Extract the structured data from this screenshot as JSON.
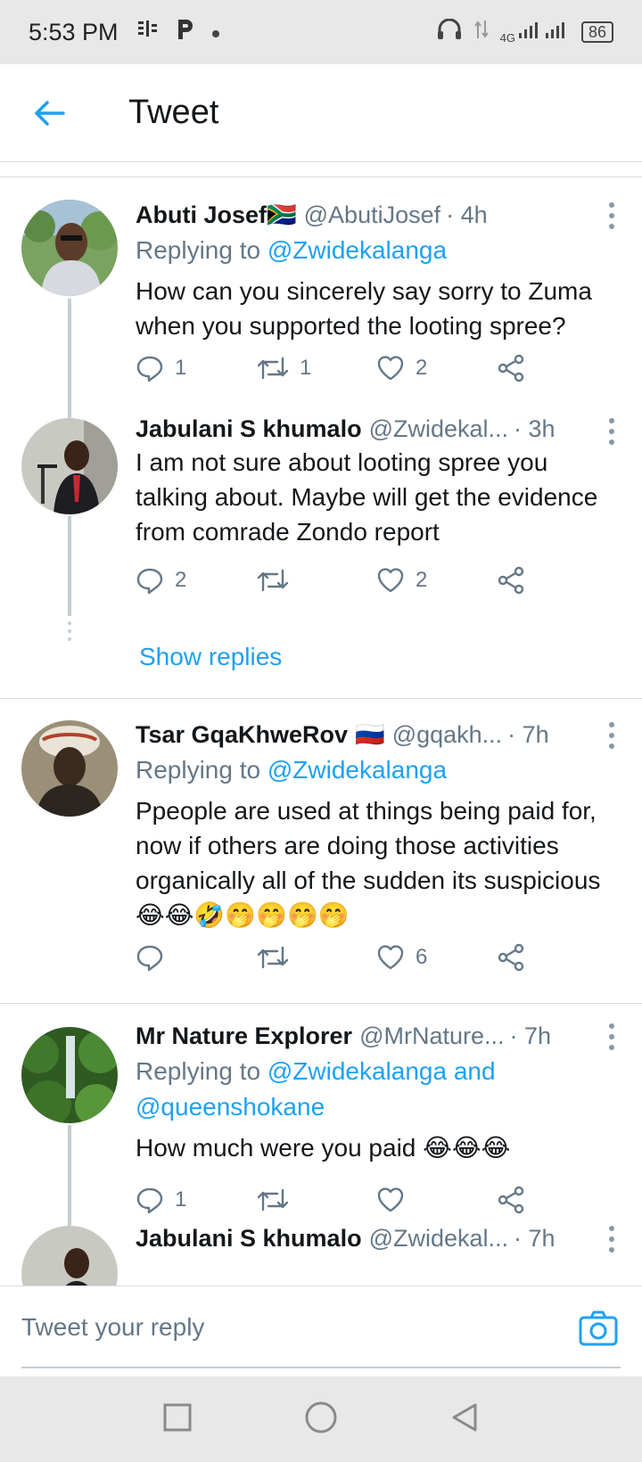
{
  "status_bar": {
    "time": "5:53 PM",
    "network": "4G",
    "battery": "86"
  },
  "header": {
    "title": "Tweet"
  },
  "tweets": [
    {
      "name": "Abuti Josef",
      "flag": "🇿🇦",
      "handle": "@AbutiJosef",
      "time": "· 4h",
      "replying_prefix": "Replying to ",
      "replying_to": "@Zwidekalanga",
      "text": "How can you sincerely say sorry to Zuma when you supported the looting spree?",
      "replies": "1",
      "retweets": "1",
      "likes": "2"
    },
    {
      "name": "Jabulani S khumalo",
      "handle": "@Zwidekal...",
      "time": "· 3h",
      "text": "I am not sure about looting spree you talking about. Maybe will get the evidence from comrade Zondo report",
      "replies": "2",
      "retweets": "",
      "likes": "2",
      "show_replies": "Show replies"
    },
    {
      "name": "Tsar GqaKhweRov",
      "flag": "🇷🇺",
      "handle": "@gqakh...",
      "time": "· 7h",
      "replying_prefix": "Replying to ",
      "replying_to": "@Zwidekalanga",
      "text": "Ppeople are used at things being paid for, now if others are doing those activities organically all of the sudden its suspicious 😂😂🤣🤭🤭🤭🤭",
      "replies": "",
      "retweets": "",
      "likes": "6"
    },
    {
      "name": "Mr Nature Explorer",
      "handle": "@MrNature...",
      "time": "· 7h",
      "replying_prefix": "Replying to ",
      "replying_to": "@Zwidekalanga and @queenshokane",
      "text": "How much were you paid 😂😂😂",
      "replies": "1",
      "retweets": "",
      "likes": ""
    },
    {
      "name": "Jabulani S khumalo",
      "handle": "@Zwidekal...",
      "time": "· 7h"
    }
  ],
  "composer": {
    "placeholder": "Tweet your reply"
  },
  "colors": {
    "accent": "#1da1f2",
    "secondary_text": "#657786",
    "divider": "#d7dde1"
  },
  "icons": [
    "back-arrow-icon",
    "more-icon",
    "reply-icon",
    "retweet-icon",
    "like-icon",
    "share-icon",
    "camera-icon",
    "nav-square-icon",
    "nav-circle-icon",
    "nav-back-icon"
  ]
}
